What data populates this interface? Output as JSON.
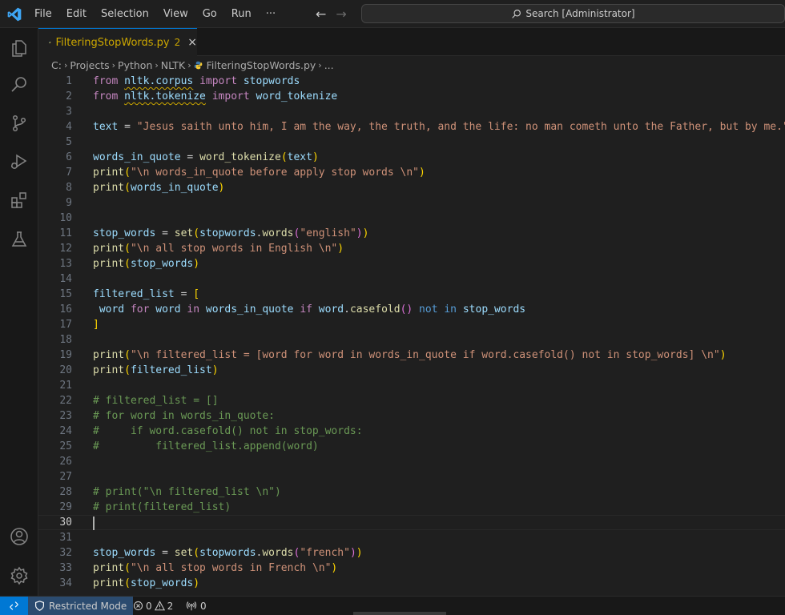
{
  "menu": [
    "File",
    "Edit",
    "Selection",
    "View",
    "Go",
    "Run",
    "···"
  ],
  "search": {
    "label": "Search [Administrator]"
  },
  "tab": {
    "name": "FilteringStopWords.py",
    "problems": "2",
    "close": "×"
  },
  "breadcrumb": [
    "C:",
    "Projects",
    "Python",
    "NLTK",
    "FilteringStopWords.py",
    "..."
  ],
  "lines": [
    {
      "n": "1",
      "t": [
        [
          "kw",
          "from"
        ],
        [
          "",
          "​ "
        ],
        [
          "v sq",
          "nltk.corpus"
        ],
        [
          "",
          " "
        ],
        [
          "kw",
          "import"
        ],
        [
          "",
          " "
        ],
        [
          "v",
          "stopwords"
        ]
      ]
    },
    {
      "n": "2",
      "t": [
        [
          "kw",
          "from"
        ],
        [
          "",
          " "
        ],
        [
          "v sq",
          "nltk.tokenize"
        ],
        [
          "",
          " "
        ],
        [
          "kw",
          "import"
        ],
        [
          "",
          " "
        ],
        [
          "v",
          "word_tokenize"
        ]
      ]
    },
    {
      "n": "3",
      "t": []
    },
    {
      "n": "4",
      "t": [
        [
          "v",
          "text"
        ],
        [
          "",
          " = "
        ],
        [
          "s",
          "\"Jesus saith unto him, I am the way, the truth, and the life: no man cometh unto the Father, but by me.\""
        ]
      ]
    },
    {
      "n": "5",
      "t": []
    },
    {
      "n": "6",
      "t": [
        [
          "v",
          "words_in_quote"
        ],
        [
          "",
          " = "
        ],
        [
          "f",
          "word_tokenize"
        ],
        [
          "b1",
          "("
        ],
        [
          "v",
          "text"
        ],
        [
          "b1",
          ")"
        ]
      ]
    },
    {
      "n": "7",
      "t": [
        [
          "f",
          "print"
        ],
        [
          "b1",
          "("
        ],
        [
          "s",
          "\"\\n words_in_quote before apply stop words \\n\""
        ],
        [
          "b1",
          ")"
        ]
      ]
    },
    {
      "n": "8",
      "t": [
        [
          "f",
          "print"
        ],
        [
          "b1",
          "("
        ],
        [
          "v",
          "words_in_quote"
        ],
        [
          "b1",
          ")"
        ]
      ]
    },
    {
      "n": "9",
      "t": []
    },
    {
      "n": "10",
      "t": []
    },
    {
      "n": "11",
      "t": [
        [
          "v",
          "stop_words"
        ],
        [
          "",
          " = "
        ],
        [
          "f",
          "set"
        ],
        [
          "b1",
          "("
        ],
        [
          "v",
          "stopwords"
        ],
        [
          "",
          "."
        ],
        [
          "f",
          "words"
        ],
        [
          "b2",
          "("
        ],
        [
          "s",
          "\"english\""
        ],
        [
          "b2",
          ")"
        ],
        [
          "b1",
          ")"
        ]
      ]
    },
    {
      "n": "12",
      "t": [
        [
          "f",
          "print"
        ],
        [
          "b1",
          "("
        ],
        [
          "s",
          "\"\\n all stop words in English \\n\""
        ],
        [
          "b1",
          ")"
        ]
      ]
    },
    {
      "n": "13",
      "t": [
        [
          "f",
          "print"
        ],
        [
          "b1",
          "("
        ],
        [
          "v",
          "stop_words"
        ],
        [
          "b1",
          ")"
        ]
      ]
    },
    {
      "n": "14",
      "t": []
    },
    {
      "n": "15",
      "t": [
        [
          "v",
          "filtered_list"
        ],
        [
          "",
          " = "
        ],
        [
          "b1",
          "["
        ]
      ]
    },
    {
      "n": "16",
      "t": [
        [
          "",
          " "
        ],
        [
          "",
          ""
        ],
        [
          "v",
          "word"
        ],
        [
          "",
          " "
        ],
        [
          "kw",
          "for"
        ],
        [
          "",
          " "
        ],
        [
          "v",
          "word"
        ],
        [
          "",
          " "
        ],
        [
          "kw",
          "in"
        ],
        [
          "",
          " "
        ],
        [
          "v",
          "words_in_quote"
        ],
        [
          "",
          " "
        ],
        [
          "kw",
          "if"
        ],
        [
          "",
          " "
        ],
        [
          "v",
          "word"
        ],
        [
          "",
          "."
        ],
        [
          "f",
          "casefold"
        ],
        [
          "b2",
          "()"
        ],
        [
          "",
          " "
        ],
        [
          "kb",
          "not"
        ],
        [
          "",
          " "
        ],
        [
          "kb",
          "in"
        ],
        [
          "",
          " "
        ],
        [
          "v",
          "stop_words"
        ]
      ]
    },
    {
      "n": "17",
      "t": [
        [
          "b1",
          "]"
        ]
      ]
    },
    {
      "n": "18",
      "t": []
    },
    {
      "n": "19",
      "t": [
        [
          "f",
          "print"
        ],
        [
          "b1",
          "("
        ],
        [
          "s",
          "\"\\n filtered_list = [word for word in words_in_quote if word.casefold() not in stop_words] \\n\""
        ],
        [
          "b1",
          ")"
        ]
      ]
    },
    {
      "n": "20",
      "t": [
        [
          "f",
          "print"
        ],
        [
          "b1",
          "("
        ],
        [
          "v",
          "filtered_list"
        ],
        [
          "b1",
          ")"
        ]
      ]
    },
    {
      "n": "21",
      "t": []
    },
    {
      "n": "22",
      "t": [
        [
          "c",
          "# filtered_list = []"
        ]
      ]
    },
    {
      "n": "23",
      "t": [
        [
          "c",
          "# for word in words_in_quote:"
        ]
      ]
    },
    {
      "n": "24",
      "t": [
        [
          "c",
          "#     if word.casefold() not in stop_words:"
        ]
      ]
    },
    {
      "n": "25",
      "t": [
        [
          "c",
          "#         filtered_list.append(word)"
        ]
      ]
    },
    {
      "n": "26",
      "t": []
    },
    {
      "n": "27",
      "t": []
    },
    {
      "n": "28",
      "t": [
        [
          "c",
          "# print(\"\\n filtered_list \\n\")"
        ]
      ]
    },
    {
      "n": "29",
      "t": [
        [
          "c",
          "# print(filtered_list)"
        ]
      ]
    },
    {
      "n": "30",
      "t": [],
      "current": true
    },
    {
      "n": "31",
      "t": []
    },
    {
      "n": "32",
      "t": [
        [
          "v",
          "stop_words"
        ],
        [
          "",
          " = "
        ],
        [
          "f",
          "set"
        ],
        [
          "b1",
          "("
        ],
        [
          "v",
          "stopwords"
        ],
        [
          "",
          "."
        ],
        [
          "f",
          "words"
        ],
        [
          "b2",
          "("
        ],
        [
          "s",
          "\"french\""
        ],
        [
          "b2",
          ")"
        ],
        [
          "b1",
          ")"
        ]
      ]
    },
    {
      "n": "33",
      "t": [
        [
          "f",
          "print"
        ],
        [
          "b1",
          "("
        ],
        [
          "s",
          "\"\\n all stop words in French \\n\""
        ],
        [
          "b1",
          ")"
        ]
      ]
    },
    {
      "n": "34",
      "t": [
        [
          "f",
          "print"
        ],
        [
          "b1",
          "("
        ],
        [
          "v",
          "stop_words"
        ],
        [
          "b1",
          ")"
        ]
      ]
    }
  ],
  "status": {
    "mode": "Restricted Mode",
    "errors": "0",
    "warnings": "2",
    "ports": "0"
  },
  "colors": {
    "accent": "#0078d4",
    "warning": "#cca700"
  }
}
